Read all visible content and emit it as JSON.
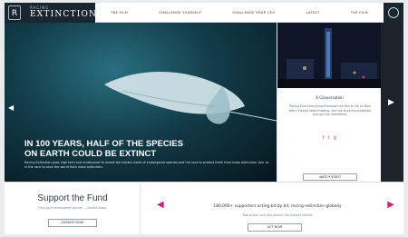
{
  "logo": {
    "mark": "R",
    "subtitle": "RACING",
    "title": "EXTINCTION"
  },
  "nav": {
    "items": [
      "THE FILM",
      "CHALLENGE YOURSELF",
      "CHALLENGE YOUR CEO",
      "LATEST",
      "THE FILM"
    ]
  },
  "hero": {
    "headline_line1": "IN 100 YEARS, HALF OF THE SPECIES",
    "headline_line2": "ON EARTH COULD BE EXTINCT",
    "body": "Racing Extinction goes high tech and undercover to reveal the hidden world of endangered species and the race to protect them from mass extinction. Join us in the race to save the world from mass extinction."
  },
  "side": {
    "title": "A Conversation",
    "text": "Racing Extinction project brought the film to life on New York's Empire State Building. See the stunning projection and join the movement.",
    "social": [
      "f",
      "t",
      "g"
    ],
    "button": "WATCH VIDEO"
  },
  "bottom": {
    "fund_title": "Support the Fund",
    "fund_sub": "Help save endangered species — donate today",
    "fund_button": "DONATE NOW",
    "pledge_text": "180,000+ supporters acting bit by bit, racing extinction globally",
    "pledge_sub": "Take action and help protect the planet's wildlife",
    "pledge_button": "ACT NOW"
  },
  "colors": {
    "brand_dark": "#1b2530",
    "accent_pink": "#d1246f",
    "hero_deep": "#06161d"
  }
}
